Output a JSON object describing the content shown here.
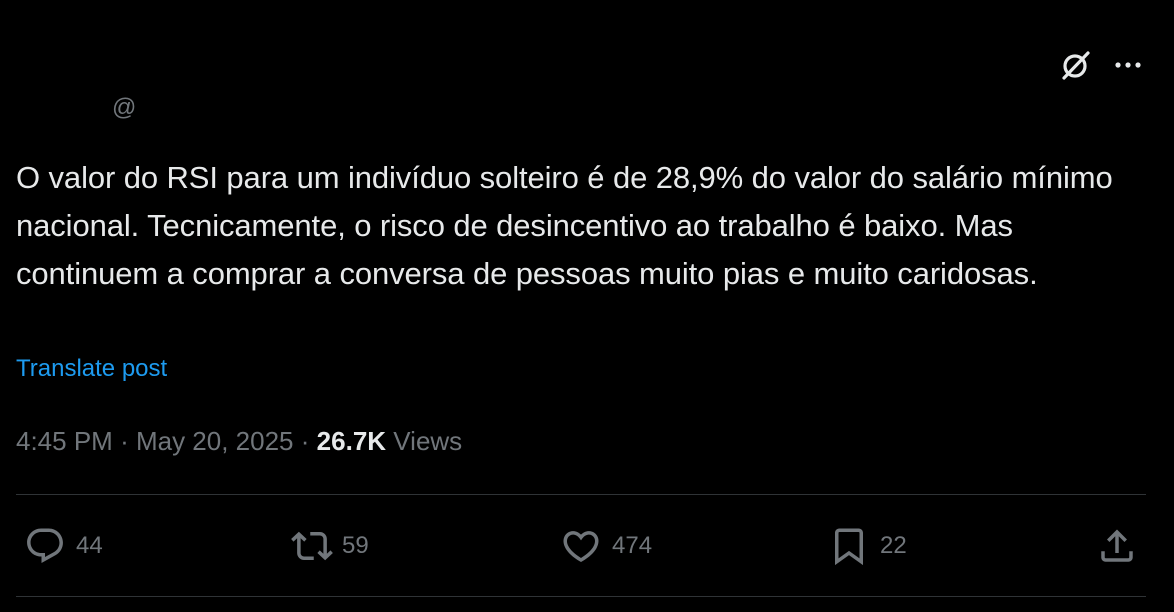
{
  "tweet": {
    "handle": "@",
    "text": "O valor do RSI para um indivíduo solteiro é de 28,9% do valor do salário mínimo nacional. Tecnicamente, o risco de desincentivo ao trabalho é baixo. Mas continuem a comprar a conversa de pessoas muito pias e muito caridosas.",
    "translate_label": "Translate post",
    "time": "4:45 PM",
    "separator": "·",
    "date": "May 20, 2025",
    "views_count": "26.7K",
    "views_label": "Views"
  },
  "actions": {
    "replies": "44",
    "reposts": "59",
    "likes": "474",
    "bookmarks": "22"
  },
  "icons": {
    "header": [
      "grok-icon",
      "more-icon"
    ],
    "actions": [
      "reply-icon",
      "repost-icon",
      "like-icon",
      "bookmark-icon",
      "share-icon"
    ]
  },
  "colors": {
    "background": "#000000",
    "text": "#e7e9ea",
    "muted": "#71767b",
    "link": "#1d9bf0",
    "divider": "#2f3336"
  }
}
